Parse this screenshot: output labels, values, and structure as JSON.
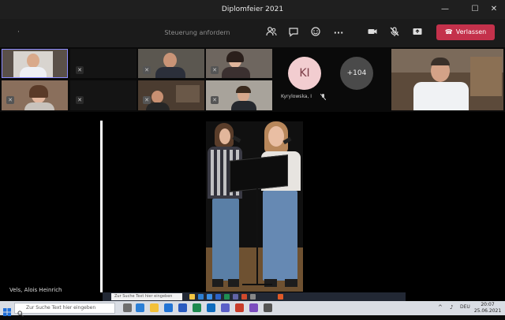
{
  "window": {
    "title": "Diplomfeier 2021",
    "minimize": "—",
    "maximize": "☐",
    "close": "✕"
  },
  "toolbar": {
    "overflow_dot": "·",
    "request_control": "Steuerung anfordern",
    "participants_icon": "people-icon",
    "chat_icon": "chat-icon",
    "reactions_icon": "reactions-icon",
    "more_label": "···",
    "camera_icon": "camera-icon",
    "mic_icon": "mic-off-icon",
    "share_icon": "share-icon",
    "leave_label": "Verlassen",
    "leave_icon": "☎"
  },
  "strip": {
    "ki_initials": "KI",
    "ki_name": "Kyrylowska, I",
    "overflow_count": "+104"
  },
  "main": {
    "presenter_name": "Vels, Alois Heinrich"
  },
  "shared_taskbar": {
    "search": "Zur Suche Text hier eingeben"
  },
  "taskbar": {
    "search": "Zur Suche Text hier eingeben",
    "time": "20:07",
    "date": "25.06.2021",
    "lang": "DEU"
  },
  "colors": {
    "leave": "#c4314b",
    "ki_avatar": "#f2cdd0",
    "active_border": "#8b8bff"
  }
}
